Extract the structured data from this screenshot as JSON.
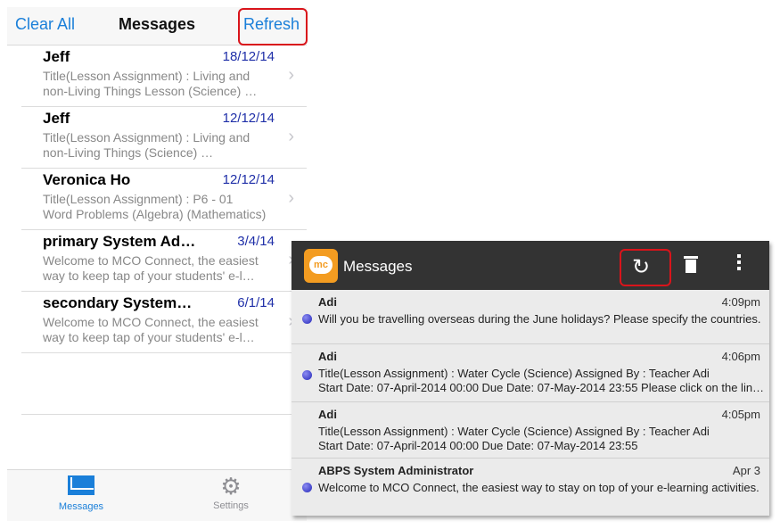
{
  "ios": {
    "nav": {
      "clear_all": "Clear All",
      "title": "Messages",
      "refresh": "Refresh"
    },
    "messages": [
      {
        "sender": "Jeff",
        "date": "18/12/14",
        "line1": "Title(Lesson Assignment) : Living and",
        "line2": "non-Living Things Lesson (Science) …"
      },
      {
        "sender": "Jeff",
        "date": "12/12/14",
        "line1": "Title(Lesson Assignment) : Living and",
        "line2": "non-Living Things (Science) …"
      },
      {
        "sender": "Veronica Ho",
        "date": "12/12/14",
        "line1": "Title(Lesson Assignment) : P6 - 01",
        "line2": "Word Problems (Algebra) (Mathematics)"
      },
      {
        "sender": "primary System Ad…",
        "date": "3/4/14",
        "line1": "Welcome to MCO Connect, the easiest",
        "line2": "way to keep tap of your students' e-l…"
      },
      {
        "sender": "secondary System…",
        "date": "6/1/14",
        "line1": "Welcome to MCO Connect, the easiest",
        "line2": "way to keep tap of your students' e-l…"
      }
    ],
    "tabs": {
      "messages": "Messages",
      "settings": "Settings"
    }
  },
  "android": {
    "title": "Messages",
    "logo_text": "mc",
    "icons": {
      "sync": "sync-icon",
      "delete": "trash-icon",
      "overflow": "more-icon"
    },
    "messages": [
      {
        "sender": "Adi",
        "time": "4:09pm",
        "line1": "Will you be travelling overseas during the June holidays? Please specify the countries.",
        "line2": ""
      },
      {
        "sender": "Adi",
        "time": "4:06pm",
        "line1": "Title(Lesson Assignment) : Water Cycle (Science)  Assigned By : Teacher Adi",
        "line2": "Start Date: 07-April-2014 00:00 Due Date: 07-May-2014 23:55  Please click on the lin…"
      },
      {
        "sender": "Adi",
        "time": "4:05pm",
        "line1": "Title(Lesson Assignment) : Water Cycle (Science)  Assigned By : Teacher Adi",
        "line2": "Start Date: 07-April-2014 00:00 Due Date: 07-May-2014 23:55"
      },
      {
        "sender": "ABPS System Administrator",
        "time": "Apr 3",
        "line1": "Welcome to MCO Connect, the easiest way to stay on top of your e-learning activities.",
        "line2": ""
      }
    ]
  },
  "colors": {
    "ios_accent": "#1a7fd9",
    "highlight": "#d9141b",
    "android_bar": "#333333",
    "logo": "#f39c21"
  }
}
